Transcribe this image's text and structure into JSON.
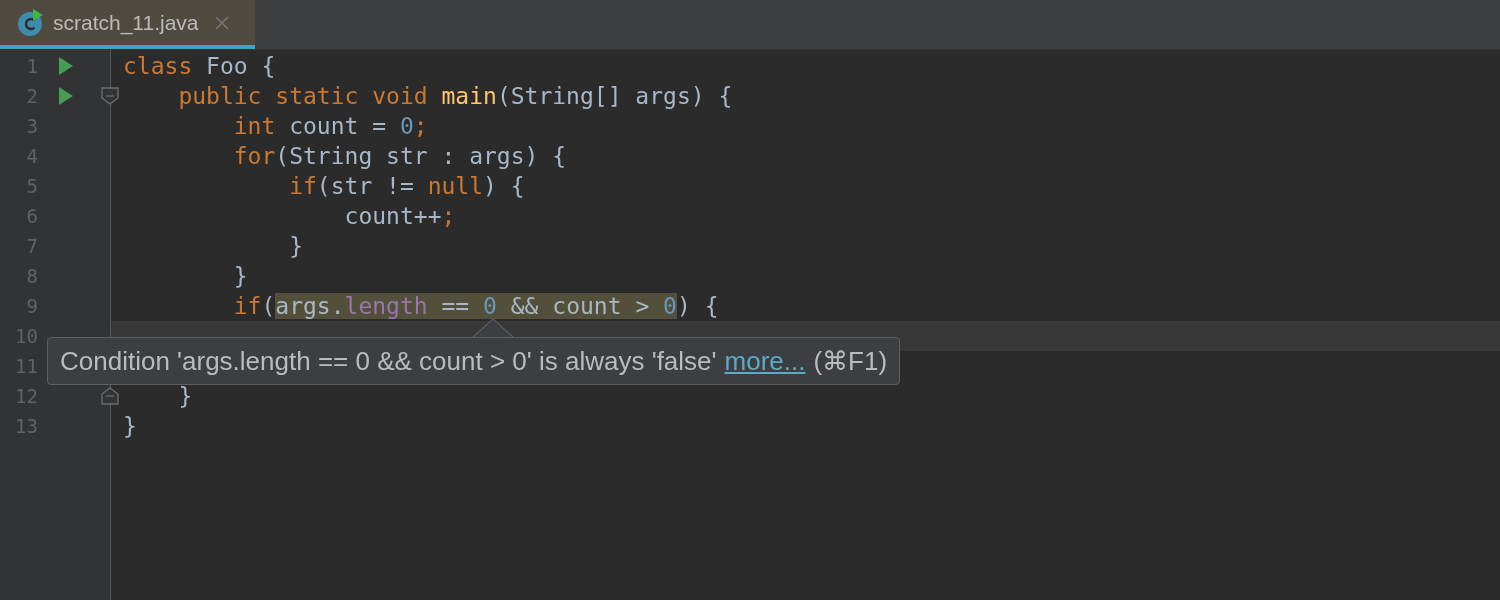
{
  "tabs": [
    {
      "label": "scratch_11.java",
      "selected": true
    }
  ],
  "editor": {
    "lines": [
      {
        "number": "1",
        "run": true,
        "current": false,
        "groups": [
          {
            "warning": false,
            "tokens": [
              {
                "text": "class",
                "kind": "keyword"
              },
              {
                "text": " Foo {",
                "kind": "plain"
              }
            ]
          }
        ],
        "children": [
          {
            "number": "2",
            "run": true,
            "kind": "foldstart",
            "current": false,
            "groups": [
              {
                "warning": false,
                "tokens": [
                  {
                    "text": "public static void ",
                    "kind": "keyword"
                  },
                  {
                    "text": "main",
                    "kind": "method"
                  },
                  {
                    "text": "(String[] args) {",
                    "kind": "plain"
                  }
                ]
              }
            ],
            "children": [
              {
                "number": "3",
                "run": false,
                "current": false,
                "groups": [
                  {
                    "warning": false,
                    "tokens": [
                      {
                        "text": "int",
                        "kind": "keyword"
                      },
                      {
                        "text": " count = ",
                        "kind": "plain"
                      },
                      {
                        "text": "0",
                        "kind": "number"
                      },
                      {
                        "text": ";",
                        "kind": "keyword"
                      }
                    ]
                  }
                ]
              },
              {
                "number": "4",
                "run": false,
                "current": false,
                "groups": [
                  {
                    "warning": false,
                    "tokens": [
                      {
                        "text": "for",
                        "kind": "keyword"
                      },
                      {
                        "text": "(String str : args) {",
                        "kind": "plain"
                      }
                    ]
                  }
                ],
                "children": [
                  {
                    "number": "5",
                    "run": false,
                    "current": false,
                    "groups": [
                      {
                        "warning": false,
                        "tokens": [
                          {
                            "text": "if",
                            "kind": "keyword"
                          },
                          {
                            "text": "(str != ",
                            "kind": "plain"
                          },
                          {
                            "text": "null",
                            "kind": "keyword"
                          },
                          {
                            "text": ") {",
                            "kind": "plain"
                          }
                        ]
                      }
                    ],
                    "children": [
                      {
                        "number": "6",
                        "run": false,
                        "current": false,
                        "groups": [
                          {
                            "warning": false,
                            "tokens": [
                              {
                                "text": "count++",
                                "kind": "plain"
                              },
                              {
                                "text": ";",
                                "kind": "keyword"
                              }
                            ]
                          }
                        ]
                      }
                    ]
                  },
                  {
                    "number": "7",
                    "run": false,
                    "current": false,
                    "groups": [
                      {
                        "warning": false,
                        "tokens": [
                          {
                            "text": "}",
                            "kind": "plain"
                          }
                        ]
                      }
                    ]
                  }
                ]
              },
              {
                "number": "8",
                "run": false,
                "current": false,
                "groups": [
                  {
                    "warning": false,
                    "tokens": [
                      {
                        "text": "}",
                        "kind": "plain"
                      }
                    ]
                  }
                ]
              },
              {
                "number": "9",
                "run": false,
                "current": false,
                "groups": [
                  {
                    "warning": false,
                    "tokens": [
                      {
                        "text": "if",
                        "kind": "keyword"
                      },
                      {
                        "text": "(",
                        "kind": "plain"
                      }
                    ]
                  },
                  {
                    "warning": true,
                    "tokens": [
                      {
                        "text": "args.",
                        "kind": "plain"
                      },
                      {
                        "text": "length",
                        "kind": "field"
                      },
                      {
                        "text": " == ",
                        "kind": "plain"
                      },
                      {
                        "text": "0",
                        "kind": "number"
                      },
                      {
                        "text": " && count > ",
                        "kind": "plain"
                      },
                      {
                        "text": "0",
                        "kind": "number"
                      }
                    ]
                  },
                  {
                    "warning": false,
                    "tokens": [
                      {
                        "text": ") {",
                        "kind": "plain"
                      }
                    ]
                  }
                ],
                "children": [
                  {
                    "number": "10",
                    "run": false,
                    "current": true
                  },
                  {
                    "number": "11",
                    "run": false,
                    "current": false
                  }
                ]
              }
            ]
          },
          {
            "number": "12",
            "run": false,
            "kind": "foldend",
            "current": false,
            "groups": [
              {
                "warning": false,
                "tokens": [
                  {
                    "text": "}",
                    "kind": "plain"
                  }
                ]
              }
            ]
          }
        ]
      },
      {
        "number": "13",
        "run": false,
        "current": false,
        "groups": [
          {
            "warning": false,
            "tokens": [
              {
                "text": "}",
                "kind": "plain"
              }
            ]
          }
        ]
      }
    ]
  },
  "tooltip": {
    "message": "Condition 'args.length == 0 && count > 0' is always 'false'",
    "link": "more...",
    "shortcut": "(⌘F1)"
  }
}
